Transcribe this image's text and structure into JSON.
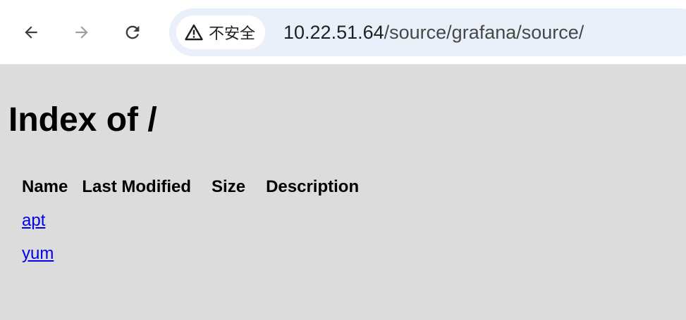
{
  "browser": {
    "security_label": "不安全",
    "url_host": "10.22.51.64",
    "url_path": "/source/grafana/source/",
    "icons": {
      "back": "arrow-left-icon",
      "forward": "arrow-right-icon",
      "reload": "reload-icon",
      "warning": "warning-triangle-icon"
    },
    "colors": {
      "toolbar_bg": "#ffffff",
      "omnibox_bg": "#eaf0fa",
      "forward_disabled": "#9e9e9e"
    }
  },
  "page": {
    "title": "Index of /",
    "background": "#dcdcdc",
    "link_color": "#0000ee",
    "columns": [
      "Name",
      "Last Modified",
      "Size",
      "Description"
    ],
    "entries": [
      {
        "name": "apt",
        "last_modified": "",
        "size": "",
        "description": ""
      },
      {
        "name": "yum",
        "last_modified": "",
        "size": "",
        "description": ""
      }
    ]
  }
}
